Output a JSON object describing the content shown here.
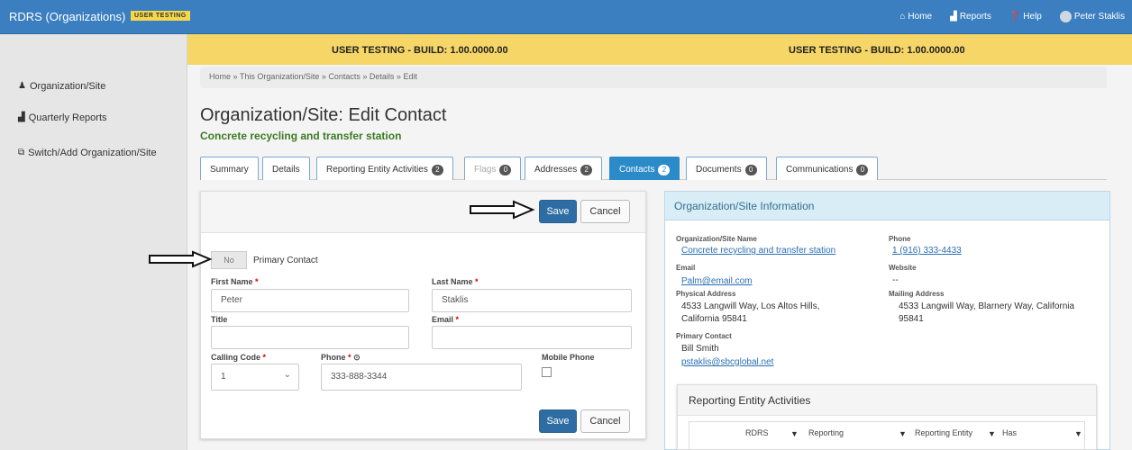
{
  "navbar": {
    "brand": "RDRS (Organizations)",
    "badge": "USER TESTING",
    "items": [
      {
        "label": "Home",
        "icon": "home-icon"
      },
      {
        "label": "Reports",
        "icon": "reports-icon"
      },
      {
        "label": "Help",
        "icon": "help-icon"
      },
      {
        "label": "Peter Staklis",
        "icon": "user-avatar"
      }
    ]
  },
  "sidebar": {
    "items": [
      {
        "label": "Organization/Site",
        "icon": "user-icon"
      },
      {
        "label": "Quarterly Reports",
        "icon": "bar-chart-icon"
      },
      {
        "label": "Switch/Add Organization/Site",
        "icon": "external-link-icon"
      }
    ]
  },
  "banner": {
    "left": "USER TESTING - BUILD: 1.00.0000.00",
    "right": "USER TESTING - BUILD: 1.00.0000.00"
  },
  "breadcrumb": "Home » This Organization/Site » Contacts » Details » Edit",
  "page": {
    "title": "Organization/Site: Edit Contact",
    "subtitle": "Concrete recycling and transfer station"
  },
  "tabs": [
    {
      "label": "Summary",
      "badge": null,
      "state": "normal"
    },
    {
      "label": "Details",
      "badge": null,
      "state": "normal"
    },
    {
      "label": "Reporting Entity Activities",
      "badge": "2",
      "state": "normal"
    },
    {
      "label": "Flags",
      "badge": "0",
      "state": "disabled"
    },
    {
      "label": "Addresses",
      "badge": "2",
      "state": "normal"
    },
    {
      "label": "Contacts",
      "badge": "2",
      "state": "active"
    },
    {
      "label": "Documents",
      "badge": "0",
      "state": "normal"
    },
    {
      "label": "Communications",
      "badge": "0",
      "state": "normal"
    }
  ],
  "form": {
    "save_label": "Save",
    "cancel_label": "Cancel",
    "toggle_value": "No",
    "toggle_label": "Primary Contact",
    "first_name_label": "First Name",
    "first_name_value": "Peter",
    "last_name_label": "Last Name",
    "last_name_value": "Staklis",
    "title_label": "Title",
    "title_value": "",
    "email_label": "Email",
    "email_value": "",
    "calling_code_label": "Calling Code",
    "calling_code_value": "1",
    "phone_label": "Phone",
    "phone_value": "333-888-3344",
    "mobile_label": "Mobile Phone",
    "required_marker": "*"
  },
  "info": {
    "title": "Organization/Site Information",
    "name_label": "Organization/Site Name",
    "name_value": "Concrete recycling and transfer station",
    "phone_label": "Phone",
    "phone_value": "1 (916) 333-4433",
    "email_label": "Email",
    "email_value": "Palm@email.com",
    "website_label": "Website",
    "website_value": "--",
    "physical_label": "Physical Address",
    "physical_line1": "4533 Langwill Way, Los Altos Hills,",
    "physical_line2": "California 95841",
    "mailing_label": "Mailing Address",
    "mailing_line1": "4533 Langwill Way, Blarnery Way, California",
    "mailing_line2": "95841",
    "primary_label": "Primary Contact",
    "primary_name": "Bill Smith",
    "primary_email": "pstaklis@sbcglobal.net"
  },
  "rea": {
    "title": "Reporting Entity Activities",
    "columns": [
      "RDRS",
      "Reporting",
      "Reporting Entity",
      "Has"
    ]
  }
}
